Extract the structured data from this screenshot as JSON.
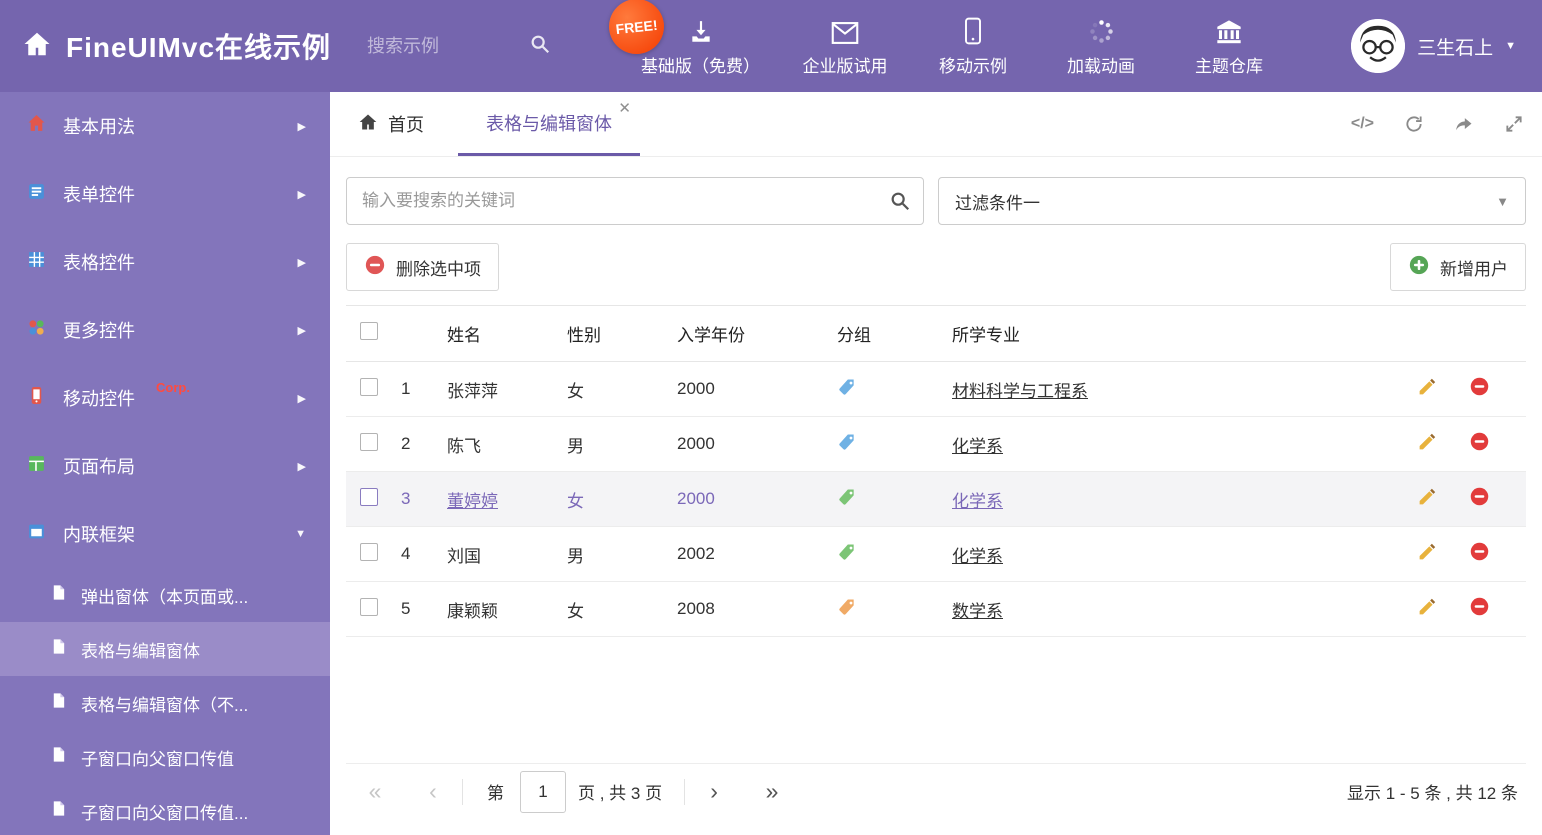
{
  "colors": {
    "header_bg": "#7565ae",
    "sidebar_bg": "#8375bb",
    "sidebar_active_bg": "#9a8cc8",
    "accent_purple": "#6b5aa8",
    "selected_row_text": "#7b68b8",
    "free_badge_bg": "#f43b00",
    "corp_badge_red": "#ff4b40",
    "edit_icon_color": "#e8b23c",
    "delete_icon_color": "#e23b3b",
    "add_icon_color": "#56a556"
  },
  "header": {
    "title": "FineUIMvc在线示例",
    "search_placeholder": "搜索示例",
    "free_badge": "FREE!",
    "nav": [
      {
        "label": "基础版（免费）",
        "icon": "download-icon"
      },
      {
        "label": "企业版试用",
        "icon": "mail-icon"
      },
      {
        "label": "移动示例",
        "icon": "mobile-icon"
      },
      {
        "label": "加载动画",
        "icon": "spinner-icon"
      },
      {
        "label": "主题仓库",
        "icon": "bank-icon"
      }
    ],
    "user": {
      "name": "三生石上"
    }
  },
  "sidebar": {
    "items": [
      {
        "label": "基本用法"
      },
      {
        "label": "表单控件"
      },
      {
        "label": "表格控件"
      },
      {
        "label": "更多控件"
      },
      {
        "label": "移动控件",
        "badge": "Corp."
      },
      {
        "label": "页面布局"
      },
      {
        "label": "内联框架"
      }
    ],
    "subitems": [
      {
        "label": "弹出窗体（本页面或..."
      },
      {
        "label": "表格与编辑窗体"
      },
      {
        "label": "表格与编辑窗体（不..."
      },
      {
        "label": "子窗口向父窗口传值"
      },
      {
        "label": "子窗口向父窗口传值..."
      }
    ]
  },
  "tabs": [
    {
      "label": "首页"
    },
    {
      "label": "表格与编辑窗体"
    }
  ],
  "filters": {
    "search_placeholder": "输入要搜索的关键词",
    "filter_value": "过滤条件一"
  },
  "toolbar": {
    "delete_label": "删除选中项",
    "add_label": "新增用户"
  },
  "table": {
    "columns": {
      "name": "姓名",
      "gender": "性别",
      "year": "入学年份",
      "group": "分组",
      "major": "所学专业"
    },
    "rows": [
      {
        "num": "1",
        "name": "张萍萍",
        "gender": "女",
        "year": "2000",
        "tag_color": "#6fb1e4",
        "major": "材料科学与工程系"
      },
      {
        "num": "2",
        "name": "陈飞",
        "gender": "男",
        "year": "2000",
        "tag_color": "#6fb1e4",
        "major": "化学系"
      },
      {
        "num": "3",
        "name": "董婷婷",
        "gender": "女",
        "year": "2000",
        "tag_color": "#7cc576",
        "major": "化学系"
      },
      {
        "num": "4",
        "name": "刘国",
        "gender": "男",
        "year": "2002",
        "tag_color": "#7cc576",
        "major": "化学系"
      },
      {
        "num": "5",
        "name": "康颖颖",
        "gender": "女",
        "year": "2008",
        "tag_color": "#f0aa66",
        "major": "数学系"
      }
    ]
  },
  "pagination": {
    "prefix": "第",
    "current_page": "1",
    "suffix": "页 , 共 3 页",
    "summary": "显示 1 - 5 条 , 共 12 条"
  }
}
